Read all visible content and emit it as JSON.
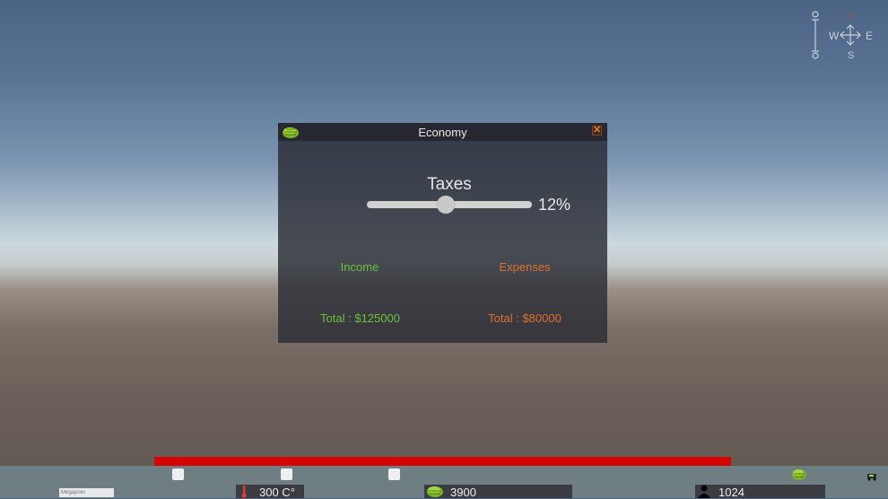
{
  "compass": {
    "north": "N",
    "west": "W",
    "east": "E",
    "south": "S"
  },
  "economy_window": {
    "title": "Economy",
    "close_glyph": "✕",
    "taxes": {
      "label": "Taxes",
      "value_text": "12%",
      "value_fraction": 0.45
    },
    "income": {
      "label": "Income",
      "total": "Total : $125000",
      "color": "#67c23c"
    },
    "expenses": {
      "label": "Expenses",
      "total": "Total : $80000",
      "color": "#dd6f2e"
    }
  },
  "progress_bar": {
    "color": "#d80404",
    "fill_fraction": 1.0
  },
  "hud": {
    "city_name_placeholder": "Megapolis",
    "temperature": "300 C°",
    "money": "3900",
    "population": "1024"
  },
  "icons": [
    "compass-icon",
    "money-icon",
    "close-icon",
    "thermometer-icon",
    "person-icon",
    "small-vehicle-icon"
  ]
}
